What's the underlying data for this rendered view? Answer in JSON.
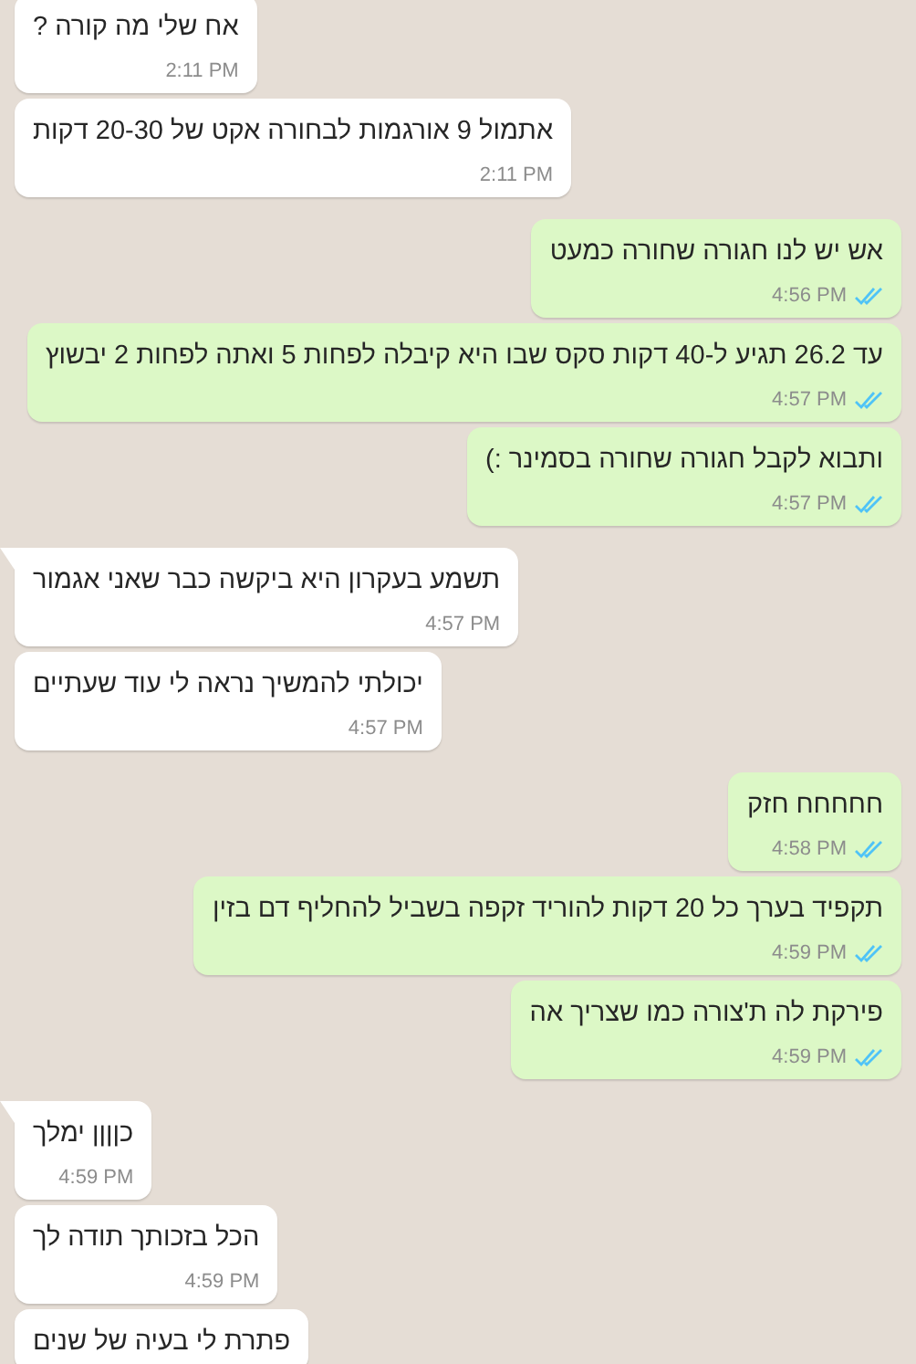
{
  "messages": [
    {
      "kind": "in",
      "tail": false,
      "text": "אח שלי מה קורה ?",
      "time": "2:11 PM"
    },
    {
      "kind": "in",
      "tail": false,
      "text": "אתמול 9 אורגמות לבחורה אקט של 20-30 דקות",
      "time": "2:11 PM"
    },
    {
      "kind": "out",
      "tail": false,
      "text": "אש יש לנו חגורה שחורה כמעט",
      "time": "4:56 PM",
      "read": true
    },
    {
      "kind": "out",
      "tail": false,
      "text": "עד 26.2 תגיע ל-40 דקות סקס שבו היא קיבלה לפחות 5 ואתה לפחות 2 יבשוץ",
      "time": "4:57 PM",
      "read": true
    },
    {
      "kind": "out",
      "tail": false,
      "text": "ותבוא לקבל חגורה שחורה בסמינר :)",
      "time": "4:57 PM",
      "read": true
    },
    {
      "kind": "in",
      "tail": true,
      "text": "תשמע בעקרון היא ביקשה כבר שאני אגמור",
      "time": "4:57 PM"
    },
    {
      "kind": "in",
      "tail": false,
      "text": "יכולתי להמשיך נראה לי עוד שעתיים",
      "time": "4:57 PM"
    },
    {
      "kind": "out",
      "tail": false,
      "text": "חחחחח חזק",
      "time": "4:58 PM",
      "read": true
    },
    {
      "kind": "out",
      "tail": false,
      "text": "תקפיד בערך כל 20 דקות להוריד זקפה בשביל להחליף דם בזין",
      "time": "4:59 PM",
      "read": true
    },
    {
      "kind": "out",
      "tail": false,
      "text": "פירקת לה ת'צורה כמו שצריך אה",
      "time": "4:59 PM",
      "read": true
    },
    {
      "kind": "in",
      "tail": true,
      "text": "כןןןן ימלך",
      "time": "4:59 PM"
    },
    {
      "kind": "in",
      "tail": false,
      "text": "הכל בזכותך תודה לך",
      "time": "4:59 PM"
    },
    {
      "kind": "in",
      "tail": false,
      "text": "פתרת לי בעיה של שנים"
    }
  ]
}
